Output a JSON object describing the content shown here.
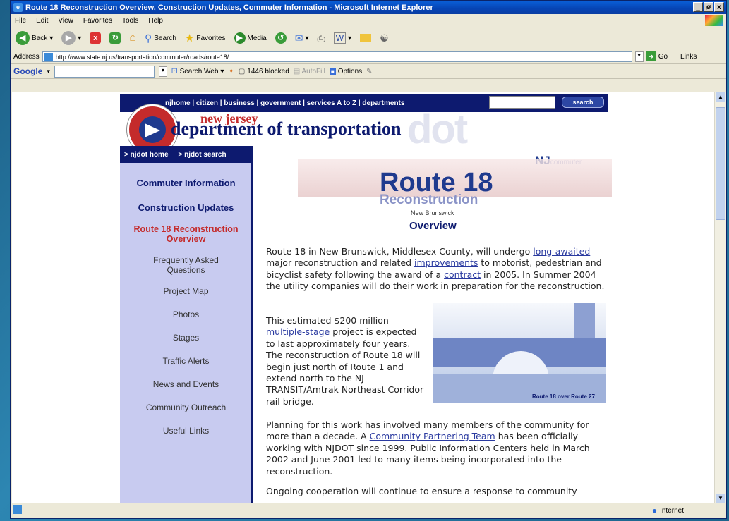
{
  "window": {
    "title": "Route 18 Reconstruction Overview, Construction Updates, Commuter Information - Microsoft Internet Explorer",
    "controls": [
      "_",
      "ø",
      "x"
    ]
  },
  "menu": [
    "File",
    "Edit",
    "View",
    "Favorites",
    "Tools",
    "Help"
  ],
  "toolbar": {
    "back": "Back",
    "search": "Search",
    "favorites": "Favorites",
    "media": "Media"
  },
  "address": {
    "label": "Address",
    "url": "http://www.state.nj.us/transportation/commuter/roads/route18/",
    "go": "Go",
    "links": "Links"
  },
  "google": {
    "brand": "Google",
    "search_web": "Search Web",
    "blocked": "1446 blocked",
    "autofill": "AutoFill",
    "options": "Options"
  },
  "status": {
    "zone": "Internet"
  },
  "page": {
    "topnav": "njhome | citizen | business | government | services A to Z | departments",
    "search_btn": "search",
    "state": "new jersey",
    "dept": "department of transportation",
    "watermark": "dot",
    "sidenav_top": [
      "> njdot home",
      "> njdot search"
    ],
    "brand_nj": "NJ",
    "brand_commuter": "commuter",
    "sidebar": [
      {
        "label": "Commuter Information"
      },
      {
        "label": "Construction Updates"
      },
      {
        "label": "Route 18 Reconstruction Overview"
      },
      {
        "label": "Frequently Asked Questions"
      },
      {
        "label": "Project Map"
      },
      {
        "label": "Photos"
      },
      {
        "label": "Stages"
      },
      {
        "label": "Traffic Alerts"
      },
      {
        "label": "News and Events"
      },
      {
        "label": "Community Outreach"
      },
      {
        "label": "Useful Links"
      }
    ],
    "title": "Route 18",
    "subtitle": "Reconstruction",
    "location": "New Brunswick",
    "section": "Overview",
    "p1": {
      "a": "Route 18 in New Brunswick, Middlesex County, will undergo ",
      "link1": "long-awaited",
      "b": " major reconstruction and related ",
      "link2": "improvements",
      "c": " to motorist, pedestrian and bicyclist safety following the award of a ",
      "link3": "contract",
      "d": " in 2005. In Summer 2004 the utility companies will do their work in preparation for the reconstruction."
    },
    "p2": {
      "a": "This estimated $200 million ",
      "link1": "multiple-stage",
      "b": " project is expected to last approximately four years. The reconstruction of Route 18 will begin just north of Route 1 and extend north to the NJ TRANSIT/Amtrak Northeast Corridor rail bridge."
    },
    "photo_caption": "Route 18 over Route 27",
    "p3": {
      "a": "Planning for this work has involved many members of the community for more than a decade. A ",
      "link1": "Community Partnering Team",
      "b": " has been officially working with NJDOT since 1999. Public Information Centers held in March 2002 and June 2001 led to many items being incorporated into the reconstruction."
    },
    "p4": "Ongoing cooperation will continue to ensure a response to community"
  }
}
